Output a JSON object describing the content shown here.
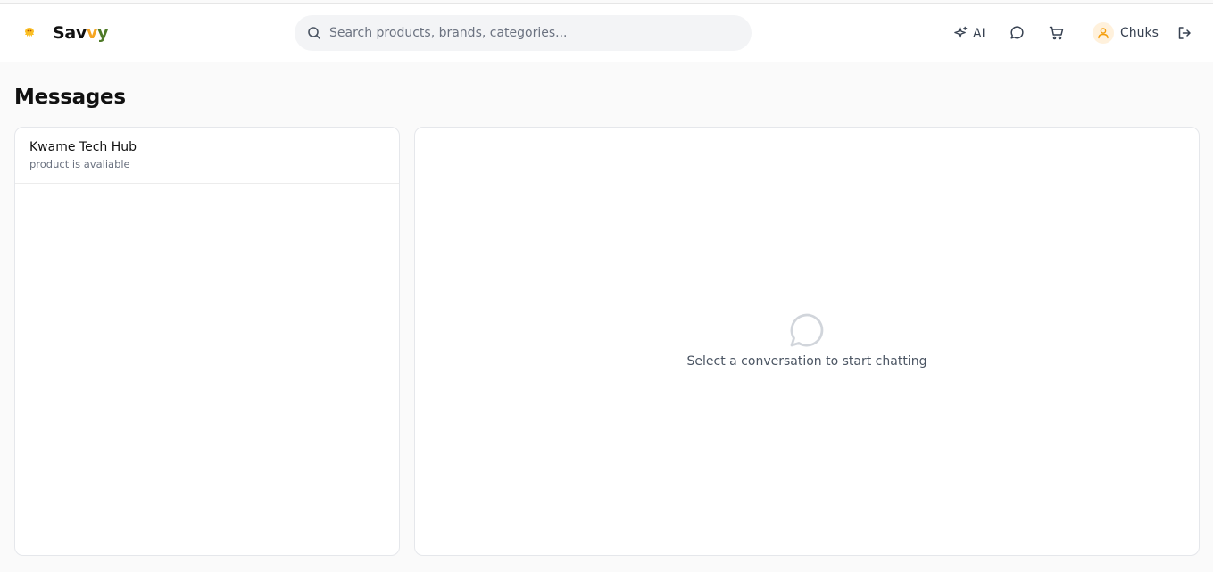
{
  "app": {
    "brand_prefix": "Sav",
    "brand_accent": "v",
    "brand_accent2": "y",
    "brand_color": "#f5a524",
    "brand_color2": "#4f7a28"
  },
  "header": {
    "search_placeholder": "Search products, brands, categories...",
    "ai_label": "AI",
    "user_name": "Chuks",
    "icons": [
      "search-icon",
      "sparkle-icon",
      "chat-icon",
      "cart-icon",
      "user-icon",
      "logout-icon"
    ]
  },
  "page": {
    "title": "Messages"
  },
  "conversations": [
    {
      "name": "Kwame Tech Hub",
      "preview": "product is avaliable"
    }
  ],
  "chat": {
    "empty_text": "Select a conversation to start chatting"
  }
}
